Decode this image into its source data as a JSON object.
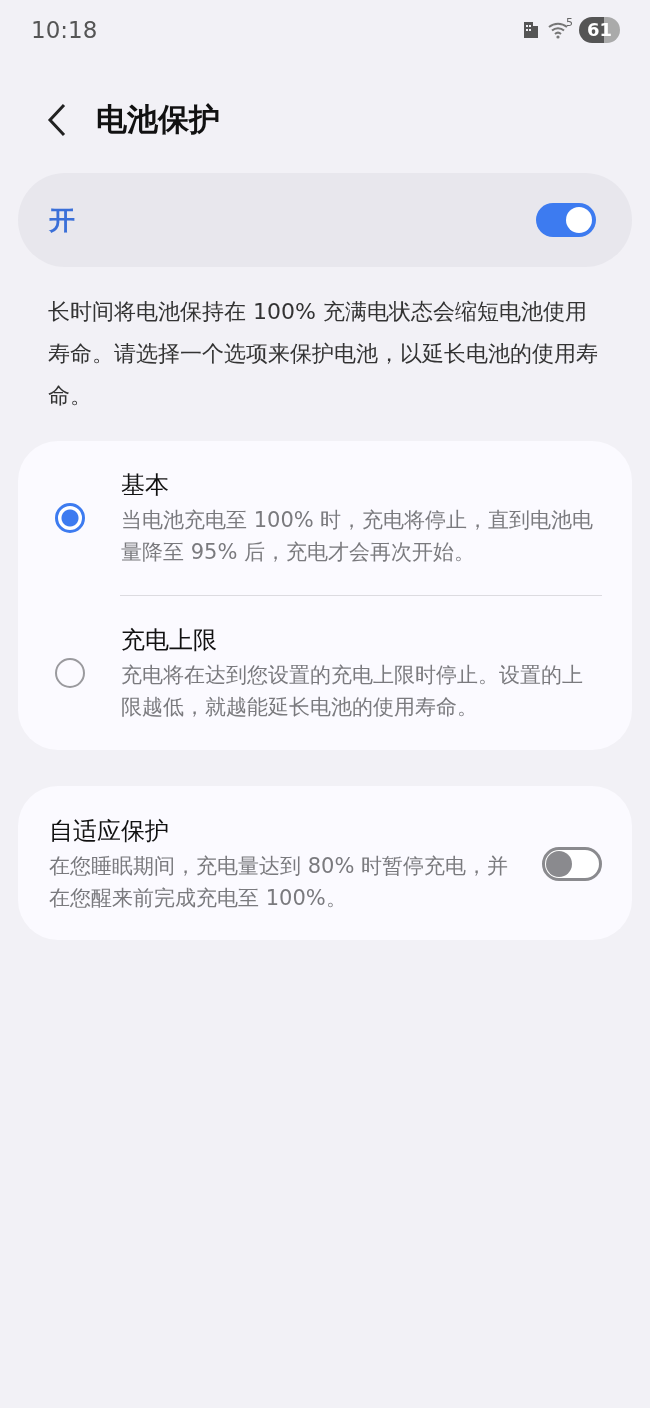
{
  "status_bar": {
    "time": "10:18",
    "wifi_badge": "5",
    "battery": "61"
  },
  "header": {
    "title": "电池保护"
  },
  "master_switch": {
    "label": "开",
    "on": true
  },
  "description": "长时间将电池保持在 100% 充满电状态会缩短电池使用寿命。请选择一个选项来保护电池，以延长电池的使用寿命。",
  "options": [
    {
      "title": "基本",
      "subtitle": "当电池充电至 100% 时，充电将停止，直到电池电量降至 95% 后，充电才会再次开始。",
      "selected": true
    },
    {
      "title": "充电上限",
      "subtitle": "充电将在达到您设置的充电上限时停止。设置的上限越低，就越能延长电池的使用寿命。",
      "selected": false
    }
  ],
  "adaptive": {
    "title": "自适应保护",
    "subtitle": "在您睡眠期间，充电量达到 80% 时暂停充电，并在您醒来前完成充电至 100%。",
    "on": false
  }
}
